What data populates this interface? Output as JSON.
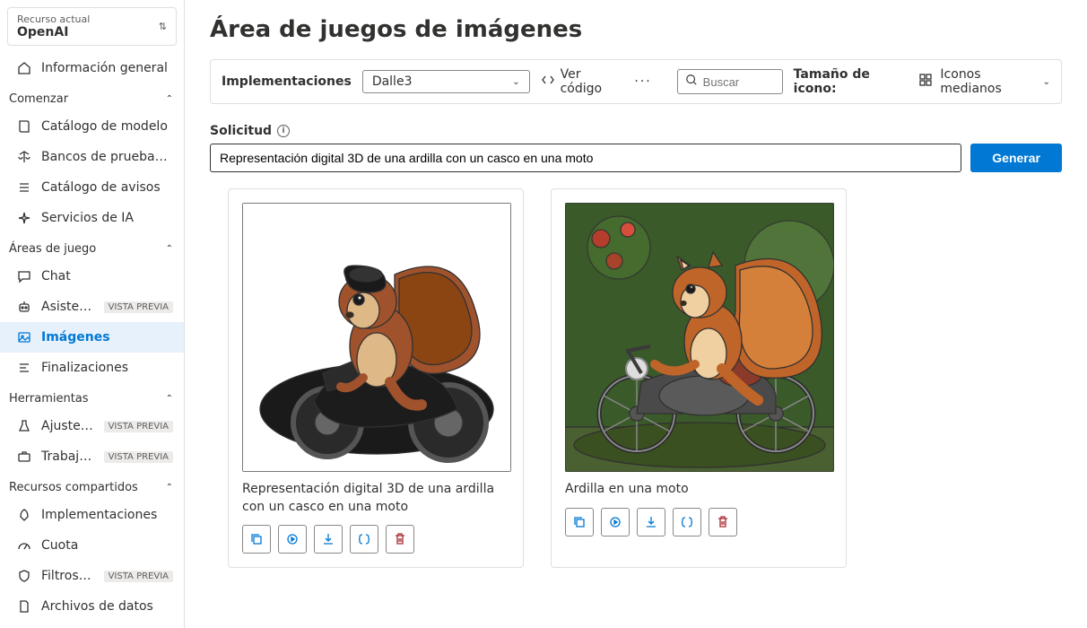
{
  "resource": {
    "label": "Recurso actual",
    "value": "OpenAI"
  },
  "nav": {
    "overview": "Información general",
    "sections": {
      "start": {
        "title": "Comenzar",
        "items": [
          "Catálogo de modelo",
          "Bancos de pruebas d...",
          "Catálogo de avisos",
          "Servicios de IA"
        ]
      },
      "play": {
        "title": "Áreas de juego",
        "items": [
          "Chat",
          "Asistentes",
          "Imágenes",
          "Finalizaciones"
        ],
        "assistants_badge": "VISTA PREVIA"
      },
      "tools": {
        "title": "Herramientas",
        "items": [
          "Ajuste preciso",
          "Trabajos por ..."
        ],
        "badge": "VISTA PREVIA"
      },
      "shared": {
        "title": "Recursos compartidos",
        "items": [
          "Implementaciones",
          "Cuota",
          "Filtros de co...",
          "Archivos de datos"
        ],
        "filters_badge": "VISTA PREVIA"
      }
    }
  },
  "page": {
    "title": "Área de juegos de imágenes"
  },
  "toolbar": {
    "deploy_label": "Implementaciones",
    "deploy_value": "Dalle3",
    "view_code": "Ver código",
    "search_placeholder": "Buscar",
    "icon_size_label": "Tamaño de icono:",
    "icon_size_value": "Iconos medianos"
  },
  "prompt": {
    "label": "Solicitud",
    "value": "Representación digital 3D de una ardilla con un casco en una moto",
    "generate": "Generar"
  },
  "cards": [
    {
      "caption": "Representación digital 3D de una ardilla con un casco en una moto"
    },
    {
      "caption": "Ardilla en una moto"
    }
  ]
}
